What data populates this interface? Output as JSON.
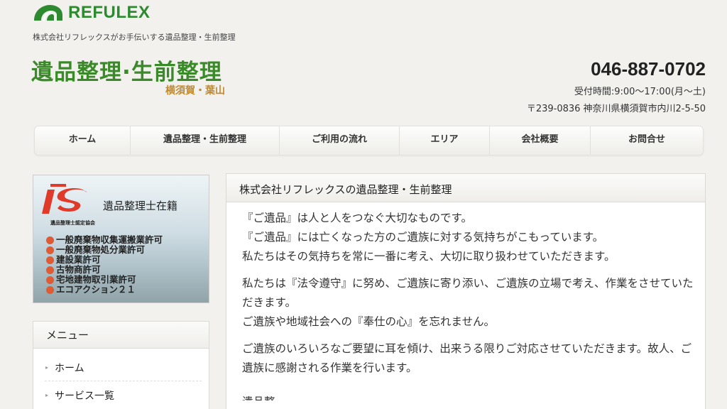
{
  "header": {
    "logo_text": "REFULEX",
    "tagline": "株式会社リフレックスがお手伝いする遺品整理・生前整理",
    "site_title": "遺品整理·生前整理",
    "site_subtitle": "横須賀・葉山",
    "phone": "046-887-0702",
    "hours": "受付時間:9:00〜17:00(月〜土)",
    "address": "〒239-0836 神奈川県横須賀市内川2-5-50"
  },
  "nav": {
    "items": [
      "ホーム",
      "遺品整理・生前整理",
      "ご利用の流れ",
      "エリア",
      "会社概要",
      "お問合せ"
    ]
  },
  "banner": {
    "title": "遺品整理士在籍",
    "small": "遺品整理士認定協会",
    "items": [
      "一般廃棄物収集運搬業許可",
      "一般廃棄物処分業許可",
      "建設業許可",
      "古物商許可",
      "宅地建物取引業許可",
      "エコアクション２１"
    ]
  },
  "menu": {
    "heading": "メニュー",
    "items": [
      "ホーム",
      "サービス一覧"
    ]
  },
  "content": {
    "heading": "株式会社リフレックスの遺品整理・生前整理",
    "paragraphs": [
      [
        "『ご遺品』は人と人をつなぐ大切なものです。",
        "『ご遺品』には亡くなった方のご遺族に対する気持ちがこもっています。",
        "私たちはその気持ちを常に一番に考え、大切に取り扱わせていただきます。"
      ],
      [
        "私たちは『法令遵守』に努め、ご遺族に寄り添い、ご遺族の立場で考え、作業をさせていただきます。",
        "ご遺族や地域社会への『奉仕の心』を忘れません。"
      ],
      [
        "ご遺族のいろいろなご要望に耳を傾け、出来うる限りご対応させていただきます。故人、ご遺族に感謝される作業を行います。"
      ]
    ],
    "cut_text": "遺品整"
  },
  "colors": {
    "brand_green": "#2d8a2f",
    "title_green": "#3b8a2a",
    "sub_gold": "#c28a2c",
    "dot_orange": "#e05a33"
  }
}
